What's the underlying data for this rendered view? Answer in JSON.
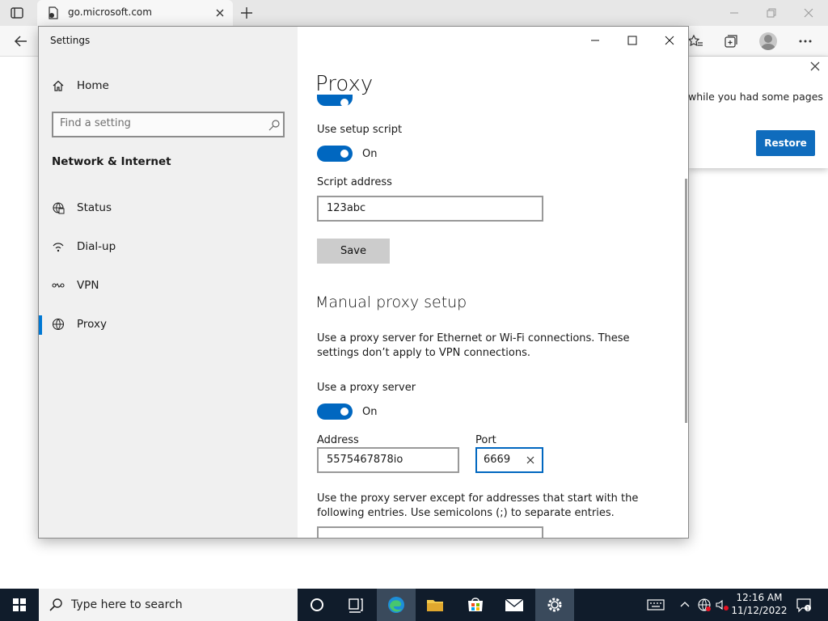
{
  "browser": {
    "tab_title": "go.microsoft.com",
    "restore_message": "while you had some pages",
    "restore_button": "Restore"
  },
  "settings": {
    "app_title": "Settings",
    "sidebar": {
      "home": "Home",
      "search_placeholder": "Find a setting",
      "section": "Network & Internet",
      "items": [
        {
          "label": "Status",
          "icon": "status-icon"
        },
        {
          "label": "Dial-up",
          "icon": "dial-up-icon"
        },
        {
          "label": "VPN",
          "icon": "vpn-icon"
        },
        {
          "label": "Proxy",
          "icon": "globe-icon",
          "selected": true
        }
      ]
    },
    "content": {
      "title": "Proxy",
      "setup_script_label": "Use setup script",
      "setup_script_state": "On",
      "script_address_label": "Script address",
      "script_address_value": "123abc",
      "save_label": "Save",
      "manual_heading": "Manual proxy setup",
      "manual_description": "Use a proxy server for Ethernet or Wi-Fi connections. These settings don’t apply to VPN connections.",
      "use_proxy_label": "Use a proxy server",
      "use_proxy_state": "On",
      "address_label": "Address",
      "address_value": "5575467878io",
      "port_label": "Port",
      "port_value": "6669",
      "exceptions_description": "Use the proxy server except for addresses that start with the following entries. Use semicolons (;) to separate entries.",
      "exceptions_value": ""
    }
  },
  "taskbar": {
    "search_placeholder": "Type here to search",
    "time": "12:16 AM",
    "date": "11/12/2022"
  },
  "colors": {
    "accent": "#0067c0",
    "taskbar": "#101c2b",
    "restore_button": "#0f6cbd"
  }
}
